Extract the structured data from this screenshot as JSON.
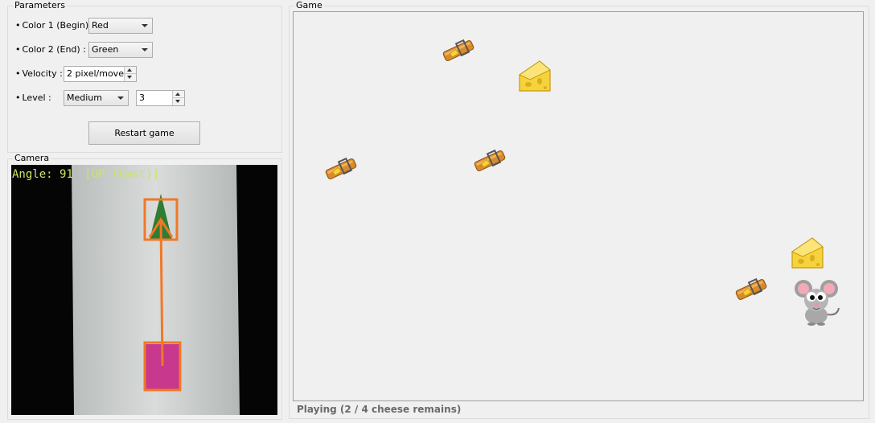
{
  "parameters": {
    "title": "Parameters",
    "color1_label": "Color 1 (Begin) :",
    "color1_value": "Red",
    "color2_label": "Color 2 (End) :",
    "color2_value": "Green",
    "velocity_label": "Velocity :",
    "velocity_value": "2  pixel/move",
    "level_label": "Level :",
    "level_value": "Medium",
    "level_number": "3",
    "restart_label": "Restart game"
  },
  "camera": {
    "title": "Camera",
    "overlay_angle": "Angle: 91",
    "overlay_direction": "[UP (East)]"
  },
  "game": {
    "title": "Game",
    "status": "Playing (2 / 4 cheese remains)",
    "icons": [
      "mousetrap-icon",
      "cheese-icon",
      "mouse-icon"
    ]
  },
  "colors": {
    "marker_begin": "#c8388c",
    "marker_end": "#2e7d32",
    "overlay_orange": "#f07828",
    "overlay_text": "#c8e664"
  }
}
